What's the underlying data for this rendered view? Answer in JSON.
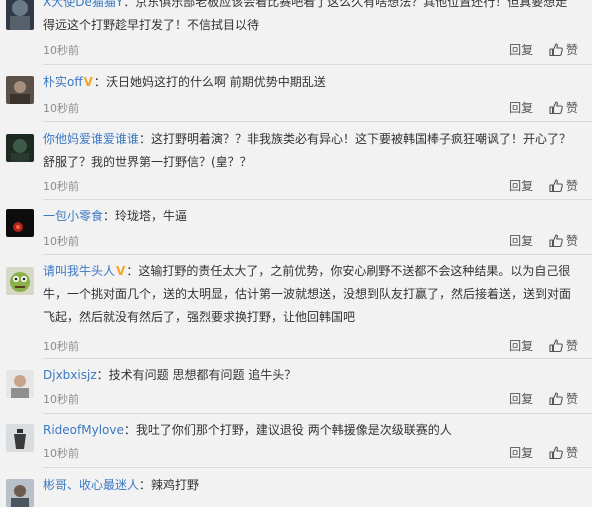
{
  "reply_label": "回复",
  "like_label": "赞",
  "comments": [
    {
      "author": "X大使De猫猫Y",
      "verified": false,
      "text": "京东俱乐部老板应该会看比赛吧看了这么久有啥想法？其他位置还行！但真要想走得远这个打野趁早打发了！不信拭目以待",
      "time": "10秒前"
    },
    {
      "author": "朴实off",
      "verified": true,
      "text": "沃日她妈这打的什么啊 前期优势中期乱送",
      "time": "10秒前"
    },
    {
      "author": "你他妈爱谁爱谁谁",
      "verified": false,
      "text": "这打野明着演？？非我族类必有异心！这下要被韩国棒子疯狂嘲讽了！开心了？舒服了？我的世界第一打野信？(皇？？",
      "time": "10秒前"
    },
    {
      "author": "一包小零食",
      "verified": false,
      "text": "玲珑塔，牛逼",
      "time": "10秒前"
    },
    {
      "author": "请叫我牛头人",
      "verified": true,
      "text": "这输打野的责任太大了，之前优势，你安心刷野不送都不会这种结果。以为自己很牛，一个挑对面几个，送的太明显，估计第一波就想送，没想到队友打赢了，然后接着送，送到对面飞起，然后就没有然后了，强烈要求换打野，让他回韩国吧",
      "time": "10秒前"
    },
    {
      "author": "Djxbxisjz",
      "verified": false,
      "text": "技术有问题 思想都有问题 追牛头？",
      "time": "10秒前"
    },
    {
      "author": "RideofMylove",
      "verified": false,
      "text": "我吐了你们那个打野，建议退役 两个韩援像是次级联赛的人",
      "time": "10秒前"
    },
    {
      "author": "彬哥、收心最迷人",
      "verified": false,
      "text": "辣鸡打野",
      "time": ""
    }
  ]
}
